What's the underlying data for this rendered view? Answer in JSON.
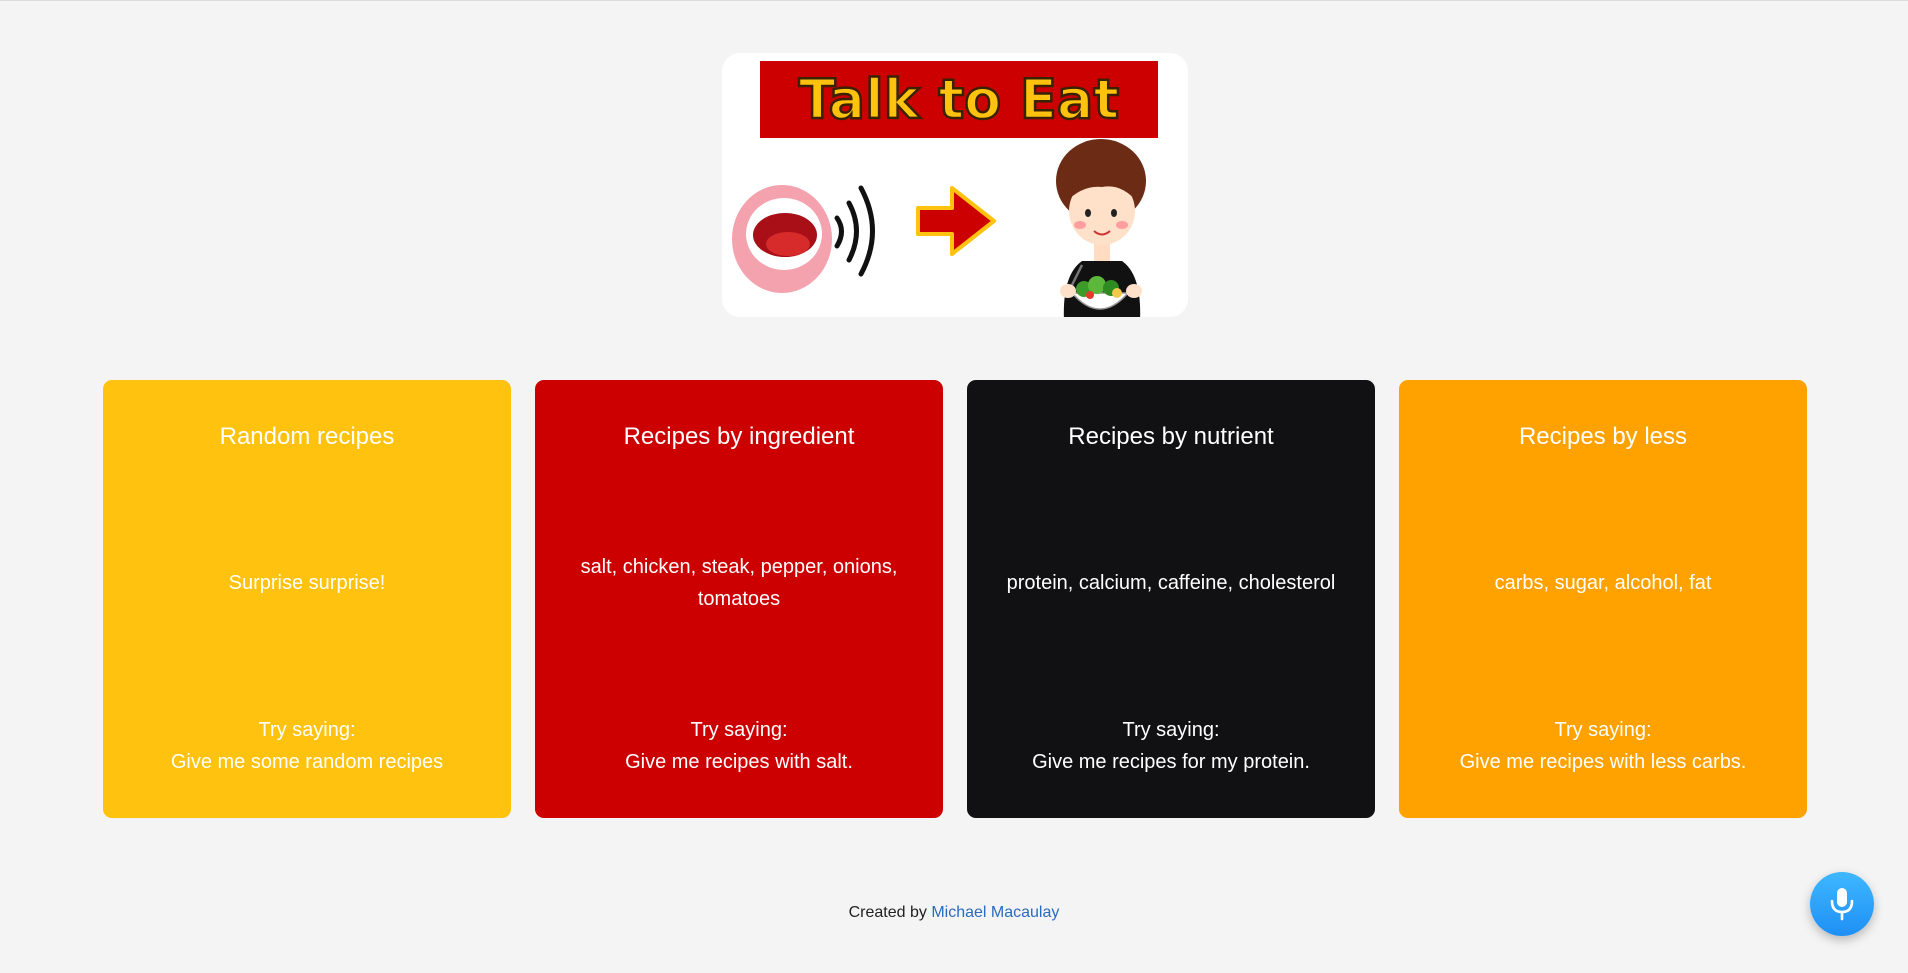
{
  "logo": {
    "text": "Talk to Eat"
  },
  "cards": [
    {
      "title": "Random recipes",
      "examples": "Surprise surprise!",
      "try_label": "Try saying:",
      "try_phrase": "Give me some random recipes",
      "color": "#ffc20e"
    },
    {
      "title": "Recipes by ingredient",
      "examples": "salt, chicken, steak, pepper, onions, tomatoes",
      "try_label": "Try saying:",
      "try_phrase": "Give me recipes with salt.",
      "color": "#cc0000"
    },
    {
      "title": "Recipes by nutrient",
      "examples": "protein, calcium, caffeine, cholesterol",
      "try_label": "Try saying:",
      "try_phrase": "Give me recipes for my protein.",
      "color": "#111113"
    },
    {
      "title": "Recipes by less",
      "examples": "carbs, sugar, alcohol, fat",
      "try_label": "Try saying:",
      "try_phrase": "Give me recipes with less carbs.",
      "color": "#ffa200"
    }
  ],
  "footer": {
    "prefix": "Created by",
    "author": "Michael Macaulay"
  },
  "mic": {
    "icon": "microphone-icon"
  },
  "colors": {
    "background": "#f4f4f4",
    "link": "#2a6bc0",
    "mic_button": "#28a4fb"
  }
}
